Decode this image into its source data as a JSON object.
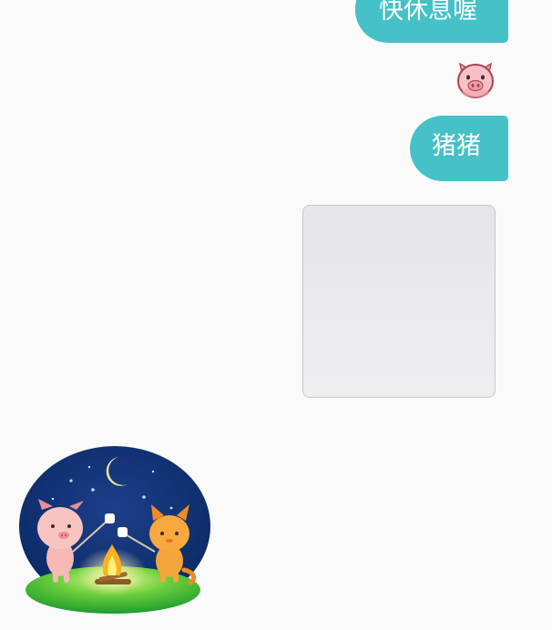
{
  "messages": [
    {
      "type": "text",
      "side": "right",
      "text": "快休息喔"
    },
    {
      "type": "emoji",
      "side": "right",
      "icon": "pig-face-icon"
    },
    {
      "type": "text",
      "side": "right",
      "text": "猪猪"
    },
    {
      "type": "image",
      "side": "right",
      "state": "loading"
    },
    {
      "type": "sticker",
      "side": "left",
      "icon": "campfire-pig-cat-sticker"
    }
  ],
  "colors": {
    "background": "#fafafa",
    "bubble": "#45c1c7",
    "bubble_text": "#ffffff"
  }
}
